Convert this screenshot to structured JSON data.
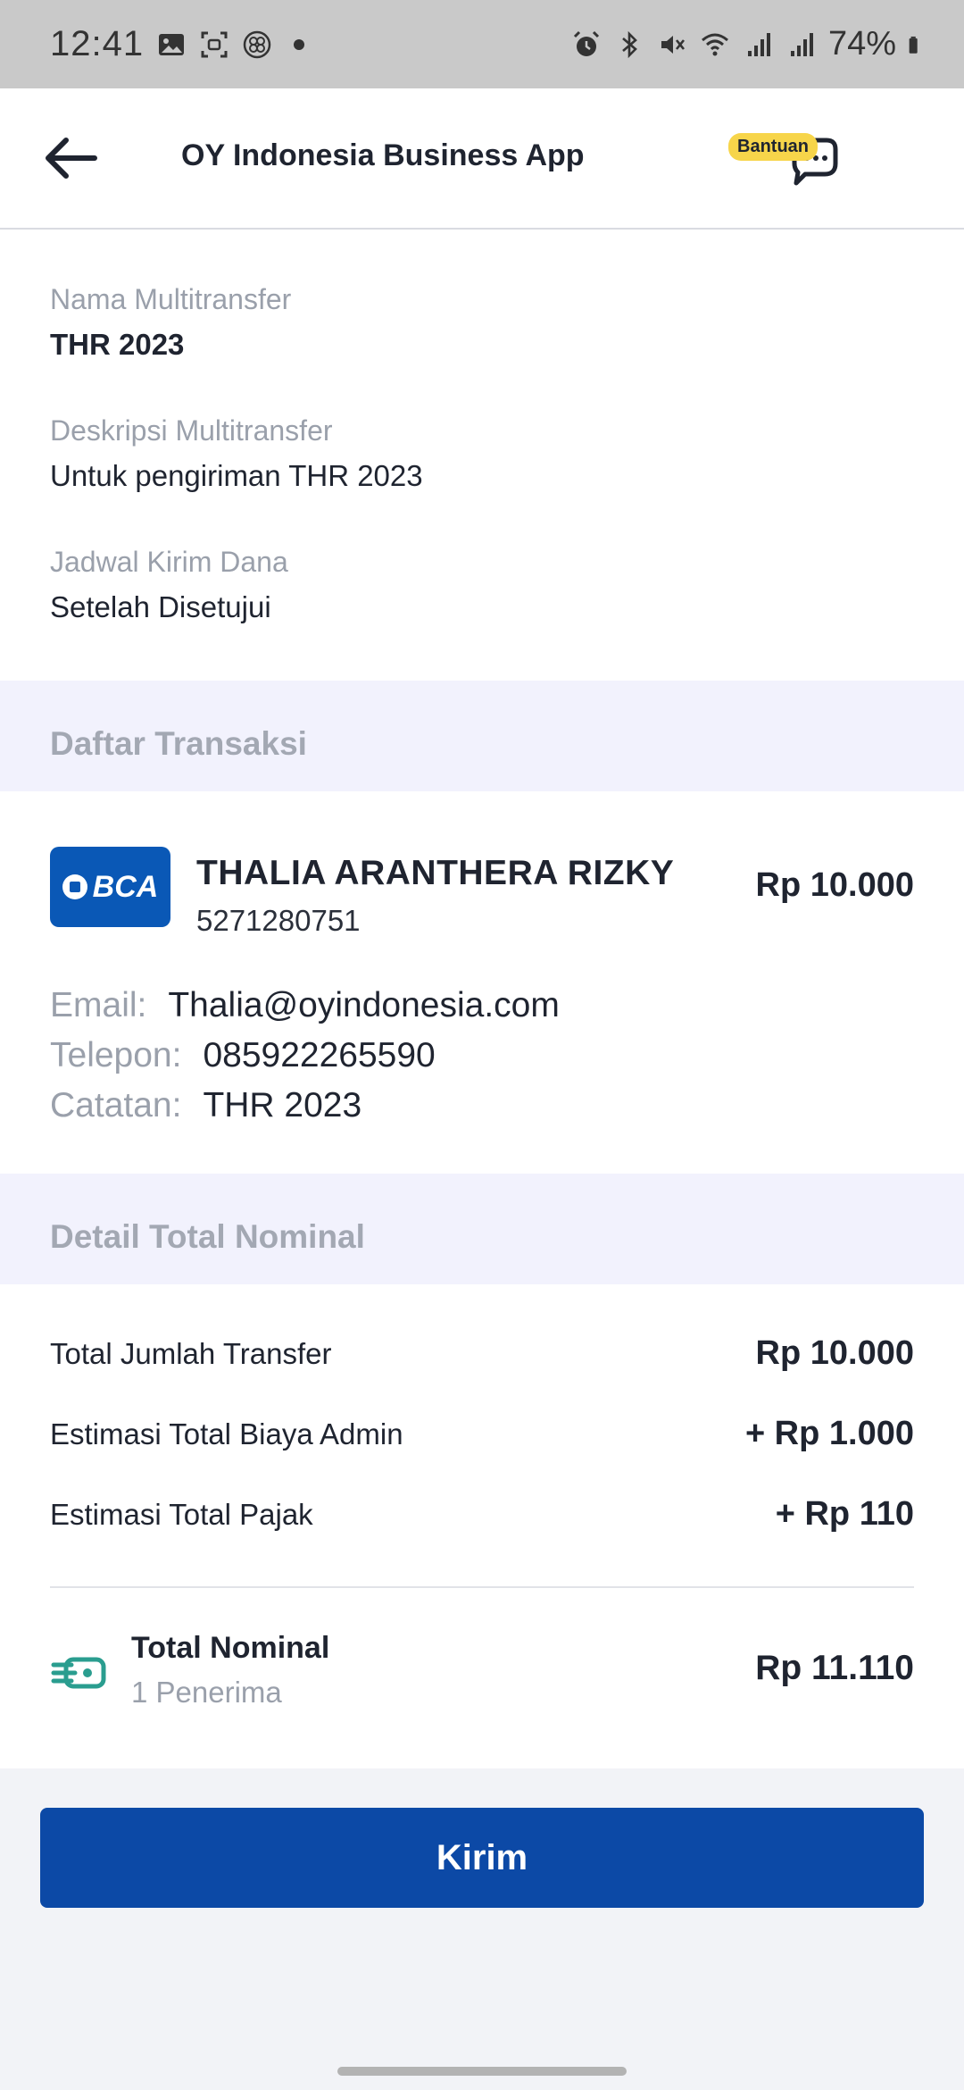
{
  "status_bar": {
    "time": "12:41",
    "battery_percent": "74%"
  },
  "app_bar": {
    "title": "OY Indonesia Business App",
    "help_badge": "Bantuan"
  },
  "info": {
    "name_label": "Nama Multitransfer",
    "name_value": "THR 2023",
    "desc_label": "Deskripsi Multitransfer",
    "desc_value": "Untuk pengiriman THR 2023",
    "schedule_label": "Jadwal Kirim Dana",
    "schedule_value": "Setelah Disetujui"
  },
  "transactions": {
    "section_title": "Daftar Transaksi",
    "items": [
      {
        "bank": "BCA",
        "name": "THALIA ARANTHERA RIZKY",
        "account": "5271280751",
        "amount": "Rp 10.000",
        "email_label": "Email:",
        "email": "Thalia@oyindonesia.com",
        "phone_label": "Telepon:",
        "phone": "085922265590",
        "note_label": "Catatan:",
        "note": "THR 2023"
      }
    ]
  },
  "totals": {
    "section_title": "Detail Total Nominal",
    "rows": [
      {
        "label": "Total Jumlah Transfer",
        "value": "Rp 10.000"
      },
      {
        "label": "Estimasi Total Biaya Admin",
        "value": "+ Rp 1.000"
      },
      {
        "label": "Estimasi Total Pajak",
        "value": "+ Rp 110"
      }
    ],
    "total_label": "Total Nominal",
    "recipients": "1 Penerima",
    "total_value": "Rp 11.110"
  },
  "actions": {
    "send_label": "Kirim"
  },
  "colors": {
    "primary": "#0c49a6",
    "bank_bca": "#0a58b6",
    "badge": "#f7d54a",
    "money_icon": "#2a9d8f"
  }
}
